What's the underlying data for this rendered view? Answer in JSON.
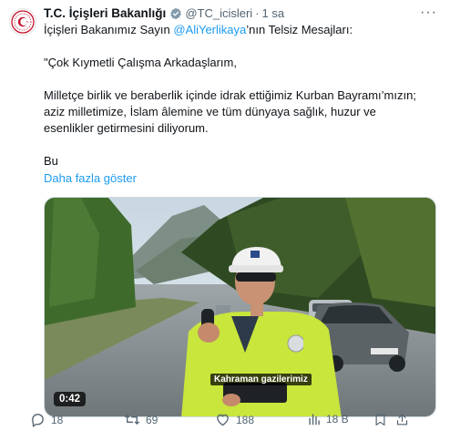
{
  "tweet": {
    "author": {
      "name": "T.C. İçişleri Bakanlığı",
      "handle": "@TC_icisleri",
      "separator": "·",
      "time": "1 sa"
    },
    "more_label": "···",
    "text": {
      "line1_prefix": "İçişleri Bakanımız Sayın ",
      "mention": "@AliYerlikaya",
      "line1_suffix": "’nın Telsiz Mesajları:",
      "para1": "\"Çok Kıymetli Çalışma Arkadaşlarım,",
      "para2": "Milletçe birlik ve beraberlik içinde idrak ettiğimiz Kurban Bayramı’mızın; aziz milletimize, İslam âlemine ve tüm dünyaya sağlık, huzur ve esenlikler getirmesini diliyorum.",
      "para3": "Bu"
    },
    "show_more": "Daha fazla göster",
    "video": {
      "duration": "0:42",
      "caption": "Kahraman gazilerimiz"
    },
    "actions": {
      "replies": "18",
      "reposts": "69",
      "likes": "188",
      "views": "18 B"
    }
  },
  "colors": {
    "accent": "#1d9bf0",
    "secondary_text": "#536471",
    "verified_badge": "#829aab",
    "vest": "#c8e63c"
  }
}
